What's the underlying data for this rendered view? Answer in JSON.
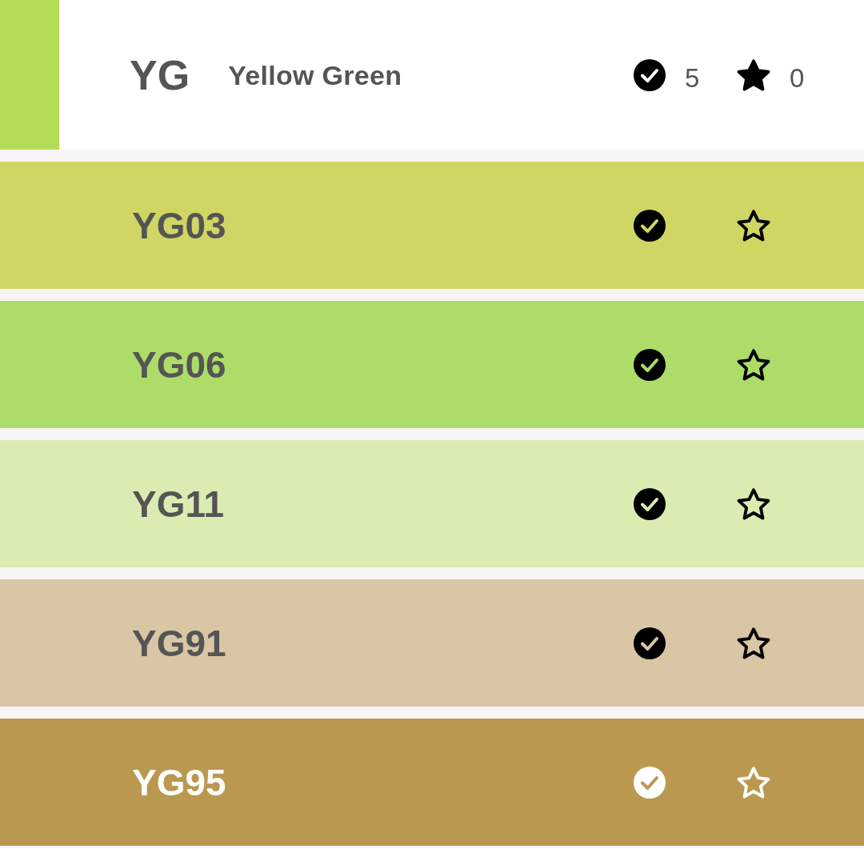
{
  "header": {
    "color": "#b5dc57",
    "code": "YG",
    "name": "Yellow Green",
    "owned_count": "5",
    "favorite_count": "0"
  },
  "rows": [
    {
      "code": "YG03",
      "color": "#d0d663",
      "checked": true,
      "starred": false
    },
    {
      "code": "YG06",
      "color": "#addc69",
      "checked": true,
      "starred": false
    },
    {
      "code": "YG11",
      "color": "#dbecb3",
      "checked": true,
      "starred": false
    },
    {
      "code": "YG91",
      "color": "#d8c6a5",
      "checked": true,
      "starred": false
    },
    {
      "code": "YG95",
      "color": "#bb984f",
      "checked": true,
      "starred": false
    }
  ]
}
